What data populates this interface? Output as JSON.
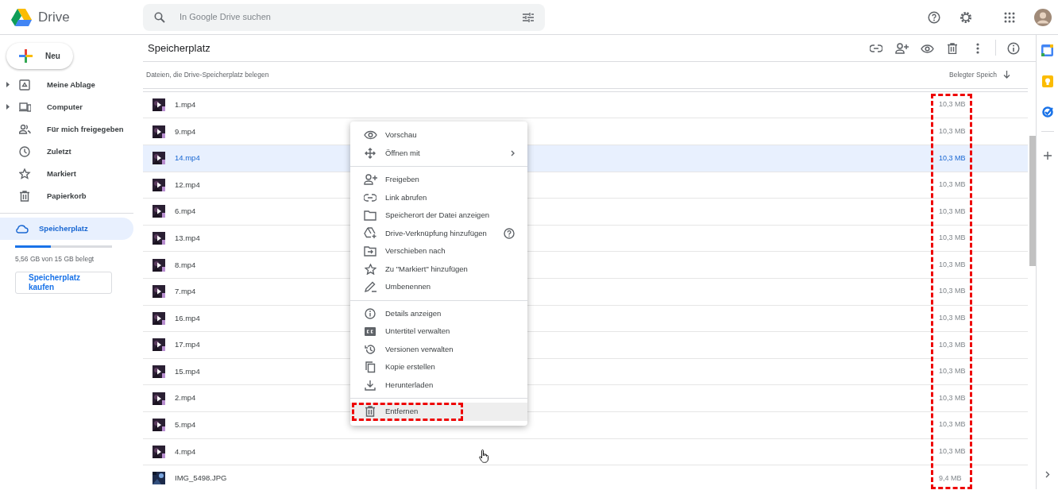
{
  "app": {
    "name": "Drive"
  },
  "search": {
    "placeholder": "In Google Drive suchen"
  },
  "new_button": "Neu",
  "sidebar": {
    "items": [
      {
        "label": "Meine Ablage",
        "expandable": true,
        "selected": false
      },
      {
        "label": "Computer",
        "expandable": true,
        "selected": false
      },
      {
        "label": "Für mich freigegeben",
        "expandable": false,
        "selected": false
      },
      {
        "label": "Zuletzt",
        "expandable": false,
        "selected": false
      },
      {
        "label": "Markiert",
        "expandable": false,
        "selected": false
      },
      {
        "label": "Papierkorb",
        "expandable": false,
        "selected": false
      }
    ],
    "storage": {
      "label": "Speicherplatz",
      "selected": true,
      "level": 0.37,
      "usage": "5,56 GB von 15 GB belegt",
      "buy_button": "Speicherplatz kaufen"
    }
  },
  "page": {
    "title": "Speicherplatz"
  },
  "list": {
    "description": "Dateien, die Drive-Speicherplatz belegen",
    "size_column": "Belegter Speich",
    "size_column_highlighted": true,
    "rows": [
      {
        "name": "1.mp4",
        "size": "10,3 MB",
        "selected": false,
        "kind": "video"
      },
      {
        "name": "9.mp4",
        "size": "10,3 MB",
        "selected": false,
        "kind": "video"
      },
      {
        "name": "14.mp4",
        "size": "10,3 MB",
        "selected": true,
        "kind": "video"
      },
      {
        "name": "12.mp4",
        "size": "10,3 MB",
        "selected": false,
        "kind": "video"
      },
      {
        "name": "6.mp4",
        "size": "10,3 MB",
        "selected": false,
        "kind": "video"
      },
      {
        "name": "13.mp4",
        "size": "10,3 MB",
        "selected": false,
        "kind": "video"
      },
      {
        "name": "8.mp4",
        "size": "10,3 MB",
        "selected": false,
        "kind": "video"
      },
      {
        "name": "7.mp4",
        "size": "10,3 MB",
        "selected": false,
        "kind": "video"
      },
      {
        "name": "16.mp4",
        "size": "10,3 MB",
        "selected": false,
        "kind": "video"
      },
      {
        "name": "17.mp4",
        "size": "10,3 MB",
        "selected": false,
        "kind": "video"
      },
      {
        "name": "15.mp4",
        "size": "10,3 MB",
        "selected": false,
        "kind": "video"
      },
      {
        "name": "2.mp4",
        "size": "10,3 MB",
        "selected": false,
        "kind": "video"
      },
      {
        "name": "5.mp4",
        "size": "10,3 MB",
        "selected": false,
        "kind": "video"
      },
      {
        "name": "4.mp4",
        "size": "10,3 MB",
        "selected": false,
        "kind": "video"
      },
      {
        "name": "IMG_5498.JPG",
        "size": "9,4 MB",
        "selected": false
      }
    ]
  },
  "context_menu": {
    "sections": [
      [
        {
          "label": "Vorschau",
          "submenu": false,
          "help": false,
          "hovered": false,
          "highlighted": false
        },
        {
          "label": "Öffnen mit",
          "submenu": true,
          "help": false,
          "hovered": false,
          "highlighted": false
        }
      ],
      [
        {
          "label": "Freigeben",
          "submenu": false,
          "help": false,
          "hovered": false,
          "highlighted": false
        },
        {
          "label": "Link abrufen",
          "submenu": false,
          "help": false,
          "hovered": false,
          "highlighted": false
        },
        {
          "label": "Speicherort der Datei anzeigen",
          "submenu": false,
          "help": false,
          "hovered": false,
          "highlighted": false
        },
        {
          "label": "Drive-Verknüpfung hinzufügen",
          "submenu": false,
          "help": true,
          "hovered": false,
          "highlighted": false
        },
        {
          "label": "Verschieben nach",
          "submenu": false,
          "help": false,
          "hovered": false,
          "highlighted": false
        },
        {
          "label": "Zu \"Markiert\" hinzufügen",
          "submenu": false,
          "help": false,
          "hovered": false,
          "highlighted": false
        },
        {
          "label": "Umbenennen",
          "submenu": false,
          "help": false,
          "hovered": false,
          "highlighted": false
        }
      ],
      [
        {
          "label": "Details anzeigen",
          "submenu": false,
          "help": false,
          "hovered": false,
          "highlighted": false
        },
        {
          "label": "Untertitel verwalten",
          "submenu": false,
          "help": false,
          "hovered": false,
          "highlighted": false
        },
        {
          "label": "Versionen verwalten",
          "submenu": false,
          "help": false,
          "hovered": false,
          "highlighted": false
        },
        {
          "label": "Kopie erstellen",
          "submenu": false,
          "help": false,
          "hovered": false,
          "highlighted": false
        },
        {
          "label": "Herunterladen",
          "submenu": false,
          "help": false,
          "hovered": false,
          "highlighted": false
        }
      ],
      [
        {
          "label": "Entfernen",
          "submenu": false,
          "help": false,
          "hovered": true,
          "highlighted": true
        }
      ]
    ]
  }
}
